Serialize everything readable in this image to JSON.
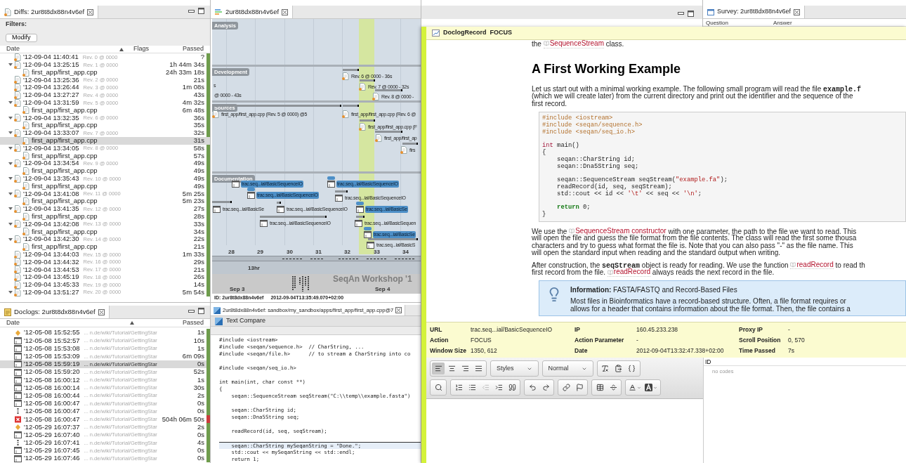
{
  "diffs": {
    "tab": "Diffs: 2ur8t8dx88n4v6ef",
    "filters_label": "Filters:",
    "modify_button": "Modify",
    "columns": [
      "Date",
      "Flags",
      "Passed"
    ],
    "rows": [
      {
        "date": "'12-09-04 11:40:41",
        "rev": "Rev. 0 @ 0000",
        "passed": "?",
        "selected": false
      },
      {
        "date": "'12-09-04 13:25:15",
        "rev": "Rev. 1 @ 0000",
        "passed": "1h 44m 34s",
        "selected": false,
        "expanded": true,
        "children": [
          {
            "name": "first_app/first_app.cpp",
            "passed": "24h 33m 18s",
            "selected": false
          }
        ]
      },
      {
        "date": "'12-09-04 13:25:36",
        "rev": "Rev. 2 @ 0000",
        "passed": "21s",
        "selected": false
      },
      {
        "date": "'12-09-04 13:26:44",
        "rev": "Rev. 3 @ 0000",
        "passed": "1m 08s",
        "selected": false
      },
      {
        "date": "'12-09-04 13:27:27",
        "rev": "Rev. 4 @ 0000",
        "passed": "43s",
        "selected": false
      },
      {
        "date": "'12-09-04 13:31:59",
        "rev": "Rev. 5 @ 0000",
        "passed": "4m 32s",
        "selected": false,
        "expanded": true,
        "children": [
          {
            "name": "first_app/first_app.cpp",
            "passed": "6m 48s",
            "selected": false
          }
        ]
      },
      {
        "date": "'12-09-04 13:32:35",
        "rev": "Rev. 6 @ 0000",
        "passed": "36s",
        "selected": false,
        "expanded": true,
        "children": [
          {
            "name": "first_app/first_app.cpp",
            "passed": "35s",
            "selected": false
          }
        ]
      },
      {
        "date": "'12-09-04 13:33:07",
        "rev": "Rev. 7 @ 0000",
        "passed": "32s",
        "selected": false,
        "expanded": true,
        "children": [
          {
            "name": "first_app/first_app.cpp",
            "passed": "31s",
            "selected": true
          }
        ]
      },
      {
        "date": "'12-09-04 13:34:05",
        "rev": "Rev. 8 @ 0000",
        "passed": "58s",
        "selected": false,
        "expanded": true,
        "children": [
          {
            "name": "first_app/first_app.cpp",
            "passed": "57s",
            "selected": false
          }
        ]
      },
      {
        "date": "'12-09-04 13:34:54",
        "rev": "Rev. 9 @ 0000",
        "passed": "49s",
        "selected": false,
        "expanded": true,
        "children": [
          {
            "name": "first_app/first_app.cpp",
            "passed": "49s",
            "selected": false
          }
        ]
      },
      {
        "date": "'12-09-04 13:35:43",
        "rev": "Rev. 10 @ 0000",
        "passed": "49s",
        "selected": false,
        "expanded": true,
        "children": [
          {
            "name": "first_app/first_app.cpp",
            "passed": "49s",
            "selected": false
          }
        ]
      },
      {
        "date": "'12-09-04 13:41:08",
        "rev": "Rev. 11 @ 0000",
        "passed": "5m 25s",
        "selected": false,
        "expanded": true,
        "children": [
          {
            "name": "first_app/first_app.cpp",
            "passed": "5m 23s",
            "selected": false
          }
        ]
      },
      {
        "date": "'12-09-04 13:41:35",
        "rev": "Rev. 12 @ 0000",
        "passed": "27s",
        "selected": false,
        "expanded": true,
        "children": [
          {
            "name": "first_app/first_app.cpp",
            "passed": "28s",
            "selected": false
          }
        ]
      },
      {
        "date": "'12-09-04 13:42:08",
        "rev": "Rev. 13 @ 0000",
        "passed": "33s",
        "selected": false,
        "expanded": true,
        "children": [
          {
            "name": "first_app/first_app.cpp",
            "passed": "34s",
            "selected": false
          }
        ]
      },
      {
        "date": "'12-09-04 13:42:30",
        "rev": "Rev. 14 @ 0000",
        "passed": "22s",
        "selected": false,
        "expanded": true,
        "children": [
          {
            "name": "first_app/first_app.cpp",
            "passed": "21s",
            "selected": false
          }
        ]
      },
      {
        "date": "'12-09-04 13:44:03",
        "rev": "Rev. 15 @ 0000",
        "passed": "1m 33s",
        "selected": false
      },
      {
        "date": "'12-09-04 13:44:32",
        "rev": "Rev. 16 @ 0000",
        "passed": "29s",
        "selected": false
      },
      {
        "date": "'12-09-04 13:44:53",
        "rev": "Rev. 17 @ 0000",
        "passed": "21s",
        "selected": false
      },
      {
        "date": "'12-09-04 13:45:19",
        "rev": "Rev. 18 @ 0000",
        "passed": "26s",
        "selected": false
      },
      {
        "date": "'12-09-04 13:45:33",
        "rev": "Rev. 19 @ 0000",
        "passed": "14s",
        "selected": false
      },
      {
        "date": "'12-09-04 13:51:27",
        "rev": "Rev. 20 @ 0000",
        "passed": "5m 54s",
        "selected": false,
        "expanded": true
      }
    ]
  },
  "doclogs": {
    "tab": "Doclogs: 2ur8t8dx88n4v6ef",
    "columns": [
      "Date",
      "Passed"
    ],
    "rows": [
      {
        "kind": "focus",
        "date": "'12-05-08 15:52:55",
        "url": "... n.de/wiki/Tutorial/GettingStar",
        "passed": "1s",
        "selected": false,
        "color": "#6e9c4c"
      },
      {
        "kind": "window",
        "date": "'12-05-08 15:52:57",
        "url": "... n.de/wiki/Tutorial/GettingStar",
        "passed": "10s",
        "selected": false,
        "color": "#6e9c4c"
      },
      {
        "kind": "window",
        "date": "'12-05-08 15:53:08",
        "url": "... n.de/wiki/Tutorial/GettingStar",
        "passed": "1s",
        "selected": false,
        "color": "#6e9c4c"
      },
      {
        "kind": "window",
        "date": "'12-05-08 15:53:09",
        "url": "... n.de/wiki/Tutorial/GettingStar",
        "passed": "6m 09s",
        "selected": false,
        "color": "#6e9c4c"
      },
      {
        "kind": "window",
        "date": "'12-05-08 15:59:19",
        "url": "... n.de/wiki/Tutorial/GettingStar",
        "passed": "0s",
        "selected": true,
        "color": "#6e9c4c"
      },
      {
        "kind": "window",
        "date": "'12-05-08 15:59:20",
        "url": "... n.de/wiki/Tutorial/GettingStar",
        "passed": "52s",
        "selected": false,
        "color": "#6e9c4c"
      },
      {
        "kind": "window",
        "date": "'12-05-08 16:00:12",
        "url": "... n.de/wiki/Tutorial/GettingStar",
        "passed": "1s",
        "selected": false,
        "color": "#6e9c4c"
      },
      {
        "kind": "window",
        "date": "'12-05-08 16:00:14",
        "url": "... n.de/wiki/Tutorial/GettingStar",
        "passed": "30s",
        "selected": false,
        "color": "#6e9c4c"
      },
      {
        "kind": "window",
        "date": "'12-05-08 16:00:44",
        "url": "... n.de/wiki/Tutorial/GettingStar",
        "passed": "2s",
        "selected": false,
        "color": "#6e9c4c"
      },
      {
        "kind": "window",
        "date": "'12-05-08 16:00:47",
        "url": "... n.de/wiki/Tutorial/GettingStar",
        "passed": "0s",
        "selected": false,
        "color": "#6e9c4c"
      },
      {
        "kind": "scroll",
        "date": "'12-05-08 16:00:47",
        "url": "... n.de/wiki/Tutorial/GettingStar",
        "passed": "0s",
        "selected": false,
        "color": "#6e9c4c"
      },
      {
        "kind": "error",
        "date": "'12-05-08 16:00:47",
        "url": "... n.de/wiki/Tutorial/GettingStar",
        "passed": "504h 06m 50s",
        "selected": false,
        "color": "#cc3b3b"
      },
      {
        "kind": "focus",
        "date": "'12-05-29 16:07:37",
        "url": "... n.de/wiki/Tutorial/GettingStar",
        "passed": "2s",
        "selected": false,
        "color": "#6e9c4c"
      },
      {
        "kind": "window",
        "date": "'12-05-29 16:07:40",
        "url": "... n.de/wiki/Tutorial/GettingStar",
        "passed": "0s",
        "selected": false,
        "color": "#6e9c4c"
      },
      {
        "kind": "scroll",
        "date": "'12-05-29 16:07:41",
        "url": "... n.de/wiki/Tutorial/GettingStar",
        "passed": "4s",
        "selected": false,
        "color": "#6e9c4c"
      },
      {
        "kind": "window",
        "date": "'12-05-29 16:07:45",
        "url": "... n.de/wiki/Tutorial/GettingStar",
        "passed": "0s",
        "selected": false,
        "color": "#6e9c4c"
      },
      {
        "kind": "window",
        "date": "'12-05-29 16:07:46",
        "url": "... n.de/wiki/Tutorial/GettingStar",
        "passed": "0s",
        "selected": false,
        "color": "#6e9c4c"
      }
    ]
  },
  "timeline": {
    "tab": "2ur8t8dx88n4v6ef",
    "lanes": [
      {
        "title": "Analysis"
      },
      {
        "title": "Development",
        "items": [
          {
            "kind": "file",
            "label": "Rev. 6 @ 0000 - 36s",
            "highlighted": false
          },
          {
            "kind": "file",
            "label": "Rev. 7 @ 0000 - 32s",
            "highlighted": false
          },
          {
            "kind": "file",
            "label": "Rev. 8 @ 0000 -",
            "highlighted": false
          },
          {
            "kind": "text",
            "label": "s",
            "highlighted": false
          },
          {
            "kind": "text",
            "label": "@ 0000 - 43s",
            "highlighted": false
          }
        ]
      },
      {
        "title": "Sources",
        "items": [
          {
            "kind": "file",
            "label": "first_app/first_app.cpp (Rev. 5 @ 0000) @5",
            "highlighted": false
          },
          {
            "kind": "file",
            "label": "first_app/first_app.cpp (Rev. 6 @",
            "highlighted": false
          },
          {
            "kind": "file",
            "label": "first_app/first_app.cpp (F",
            "highlighted": false
          },
          {
            "kind": "file",
            "label": "first_app/first_ap",
            "highlighted": false
          },
          {
            "kind": "file",
            "label": "firs",
            "highlighted": false
          }
        ]
      },
      {
        "title": "Documentation",
        "items": [
          {
            "kind": "page",
            "label": "trac.seq...ial/BasicSequenceIO",
            "highlighted": true
          },
          {
            "kind": "page",
            "label": "trac.seq...ial/BasicSequenceIO",
            "highlighted": true
          },
          {
            "kind": "page",
            "label": "trac.seq...ial/BasicSequenceIO",
            "highlighted": true
          },
          {
            "kind": "page",
            "label": "trac.seq...ial/BasicSequenceIO",
            "highlighted": false
          },
          {
            "kind": "page",
            "label": "trac.seq...ial/BasicSe",
            "highlighted": false
          },
          {
            "kind": "page",
            "label": "trac.seq...ial/BasicSequenceIO",
            "highlighted": false
          },
          {
            "kind": "page",
            "label": "trac.seq...ial/BasicSe",
            "highlighted": true
          },
          {
            "kind": "page",
            "label": "trac.seq...ial/BasicSequenceIO",
            "highlighted": false
          },
          {
            "kind": "page",
            "label": "trac.seq...ial/BasicSequen",
            "highlighted": false
          },
          {
            "kind": "page",
            "label": "trac.seq...ial/BasicSe",
            "highlighted": true
          },
          {
            "kind": "page",
            "label": "trac.seq...ial/BasicS",
            "highlighted": false
          }
        ]
      }
    ],
    "ticks": [
      "28",
      "29",
      "30",
      "31",
      "32",
      "33",
      "34"
    ],
    "overview_label": "13hr",
    "dates": [
      "Sep 3",
      "Sep 4"
    ],
    "event": "SeqAn Workshop '1",
    "footer_id": "ID: 2ur8t8dx88n4v6ef",
    "footer_date": "2012-09-04T13:35:49.070+02:00"
  },
  "compare": {
    "tab": "2ur8t8dx88n4v6ef: sandbox/my_sandbox/apps/first_app/first_app.cpp@7",
    "title": "Text Compare",
    "lines": [
      {
        "text": "#include <iostream>",
        "changed": false,
        "blank_before": false
      },
      {
        "text": "#include <seqan/sequence.h>  // CharString, ...",
        "changed": false,
        "blank_before": false
      },
      {
        "text": "#include <seqan/file.h>      // to stream a CharString into co",
        "changed": false,
        "blank_before": false
      },
      {
        "text": "#include <seqan/seq_io.h>",
        "changed": false,
        "blank_before": true
      },
      {
        "text": "int main(int, char const **)",
        "changed": false,
        "blank_before": true
      },
      {
        "text": "{",
        "changed": false,
        "blank_before": false
      },
      {
        "text": "    seqan::SequenceStream seqStream(\"C:\\\\temp\\\\example.fasta\")",
        "changed": false,
        "blank_before": false
      },
      {
        "text": "    seqan::CharString id;",
        "changed": false,
        "blank_before": true
      },
      {
        "text": "    seqan::Dna5String seq;",
        "changed": false,
        "blank_before": false
      },
      {
        "text": "    readRecord(id, seq, seqStream);",
        "changed": false,
        "blank_before": true
      },
      {
        "text": "    seqan::CharString mySeqanString = \"Done.\";",
        "changed": true,
        "blank_before": true
      },
      {
        "text": "    std::cout << mySeqanString << std::endl;",
        "changed": false,
        "blank_before": false
      },
      {
        "text": "    return 1;",
        "changed": false,
        "blank_before": false
      }
    ]
  },
  "survey": {
    "tab": "Survey: 2ur8t8dx88n4v6ef",
    "columns": [
      "Question",
      "Answer"
    ]
  },
  "record": {
    "title": "DoclogRecord",
    "action": "FOCUS",
    "top_line": [
      {
        "kind": "text",
        "t": "the "
      },
      {
        "kind": "link",
        "t": "SequenceStream"
      },
      {
        "kind": "text",
        "t": " class."
      }
    ],
    "heading": "A First Working Example",
    "para1": [
      [
        {
          "kind": "text",
          "t": "Let us start out with a minimal working example. The following small program will read the file "
        },
        {
          "kind": "code",
          "t": "example.f"
        }
      ],
      [
        {
          "kind": "text",
          "t": "(which we will create later) from the current directory and print out the identifier and the sequence of the"
        }
      ],
      [
        {
          "kind": "text",
          "t": "first record."
        }
      ]
    ],
    "code": [
      {
        "blank_before": false,
        "segs": [
          {
            "kind": "pre",
            "t": "#include <iostream>"
          }
        ]
      },
      {
        "blank_before": false,
        "segs": [
          {
            "kind": "pre",
            "t": "#include <seqan/sequence.h>"
          }
        ]
      },
      {
        "blank_before": false,
        "segs": [
          {
            "kind": "pre",
            "t": "#include <seqan/seq_io.h>"
          }
        ]
      },
      {
        "blank_before": true,
        "segs": [
          {
            "kind": "kw",
            "t": "int"
          },
          {
            "kind": "plain",
            "t": " main()"
          }
        ]
      },
      {
        "blank_before": false,
        "segs": [
          {
            "kind": "plain",
            "t": "{"
          }
        ]
      },
      {
        "blank_before": false,
        "segs": [
          {
            "kind": "plain",
            "t": "    seqan::CharString id;"
          }
        ]
      },
      {
        "blank_before": false,
        "segs": [
          {
            "kind": "plain",
            "t": "    seqan::Dna5String seq;"
          }
        ]
      },
      {
        "blank_before": true,
        "segs": [
          {
            "kind": "plain",
            "t": "    seqan::SequenceStream seqStream("
          },
          {
            "kind": "str",
            "t": "\"example.fa\""
          },
          {
            "kind": "plain",
            "t": ");"
          }
        ]
      },
      {
        "blank_before": false,
        "segs": [
          {
            "kind": "plain",
            "t": "    readRecord(id, seq, seqStream);"
          }
        ]
      },
      {
        "blank_before": false,
        "segs": [
          {
            "kind": "plain",
            "t": "    std::cout << id << "
          },
          {
            "kind": "str",
            "t": "'\\t'"
          },
          {
            "kind": "plain",
            "t": " << seq << "
          },
          {
            "kind": "str",
            "t": "'\\n'"
          },
          {
            "kind": "plain",
            "t": ";"
          }
        ]
      },
      {
        "blank_before": true,
        "segs": [
          {
            "kind": "ret",
            "t": "    return"
          },
          {
            "kind": "plain",
            "t": " 0;"
          }
        ]
      },
      {
        "blank_before": false,
        "segs": [
          {
            "kind": "plain",
            "t": "}"
          }
        ]
      }
    ],
    "para2": [
      [
        {
          "kind": "text",
          "t": "We use the "
        },
        {
          "kind": "link",
          "t": "SequenceStream constructor"
        },
        {
          "kind": "text",
          "t": " with one parameter, the path to the file we want to read. This"
        }
      ],
      [
        {
          "kind": "text",
          "t": "will open the file and guess the file format from the file contents. The class will read the first some thousa"
        }
      ],
      [
        {
          "kind": "text",
          "t": "characters and try to guess what format the file is. Note that you can also pass \"-\" as the file name. This"
        }
      ],
      [
        {
          "kind": "text",
          "t": "will open the standard input when reading and the standard output when writing."
        }
      ]
    ],
    "para3": [
      [
        {
          "kind": "text",
          "t": "After construction, the "
        },
        {
          "kind": "code",
          "t": "seqStream"
        },
        {
          "kind": "text",
          "t": " object is ready for reading. We use the function "
        },
        {
          "kind": "link",
          "t": "readRecord"
        },
        {
          "kind": "text",
          "t": " to read th"
        }
      ],
      [
        {
          "kind": "text",
          "t": "first record from the file. "
        },
        {
          "kind": "link",
          "t": "readRecord"
        },
        {
          "kind": "text",
          "t": " always reads the next record in the file."
        }
      ]
    ],
    "info_title": "**Information:** FASTA/FASTQ and Record-Based Files",
    "info_lines": [
      "Most files in Bioinformatics have a record-based structure. Often, a file format requires or",
      "allows for a header that contains information about the file format. Then, the file contains a"
    ],
    "fields": [
      {
        "label": "URL",
        "value": "trac.seq...ial/BasicSequenceIO"
      },
      {
        "label": "IP",
        "value": "160.45.233.238"
      },
      {
        "label": "Proxy IP",
        "value": "-"
      },
      {
        "label": "Action",
        "value": "FOCUS"
      },
      {
        "label": "Action Parameter",
        "value": "-"
      },
      {
        "label": "Scroll Position",
        "value": "0, 570"
      },
      {
        "label": "Window Size",
        "value": "1350, 612"
      },
      {
        "label": "Date",
        "value": "2012-09-04T13:32:47.338+02:00"
      },
      {
        "label": "Time Passed",
        "value": "7s"
      }
    ],
    "toolbar": [
      [
        [
          {
            "kind": "align-left",
            "pressed": true,
            "disabled": false
          },
          {
            "kind": "align-center",
            "pressed": false,
            "disabled": false
          },
          {
            "kind": "align-right",
            "pressed": false,
            "disabled": false
          },
          {
            "kind": "align-justify",
            "pressed": false,
            "disabled": false
          }
        ],
        [
          {
            "kind": "dropdown",
            "label": "Styles",
            "pressed": false,
            "disabled": false
          }
        ],
        [
          {
            "kind": "dropdown",
            "label": "Normal",
            "pressed": false,
            "disabled": false
          }
        ],
        [
          {
            "kind": "clear-format",
            "pressed": false,
            "disabled": false
          },
          {
            "kind": "paste",
            "pressed": false,
            "disabled": false
          },
          {
            "kind": "code",
            "pressed": false,
            "disabled": false
          }
        ]
      ],
      [
        [
          {
            "kind": "search",
            "pressed": false,
            "disabled": false
          }
        ],
        [
          {
            "kind": "numbered-list",
            "pressed": false,
            "disabled": false
          },
          {
            "kind": "bullet-list",
            "pressed": false,
            "disabled": false
          },
          {
            "kind": "outdent",
            "pressed": false,
            "disabled": true
          },
          {
            "kind": "indent",
            "pressed": false,
            "disabled": false
          },
          {
            "kind": "quote",
            "pressed": false,
            "disabled": false
          }
        ],
        [
          {
            "kind": "undo",
            "pressed": false,
            "disabled": false
          },
          {
            "kind": "redo",
            "pressed": false,
            "disabled": false
          }
        ],
        [
          {
            "kind": "link",
            "pressed": false,
            "disabled": false
          },
          {
            "kind": "flag",
            "pressed": false,
            "disabled": false
          }
        ],
        [
          {
            "kind": "table",
            "pressed": false,
            "disabled": false
          },
          {
            "kind": "rule",
            "pressed": false,
            "disabled": false
          }
        ],
        [
          {
            "kind": "text-color",
            "pressed": false,
            "disabled": false
          },
          {
            "kind": "bg-color",
            "pressed": false,
            "disabled": false
          }
        ]
      ]
    ],
    "codes_header": "ID",
    "codes_placeholder": "no codes"
  }
}
